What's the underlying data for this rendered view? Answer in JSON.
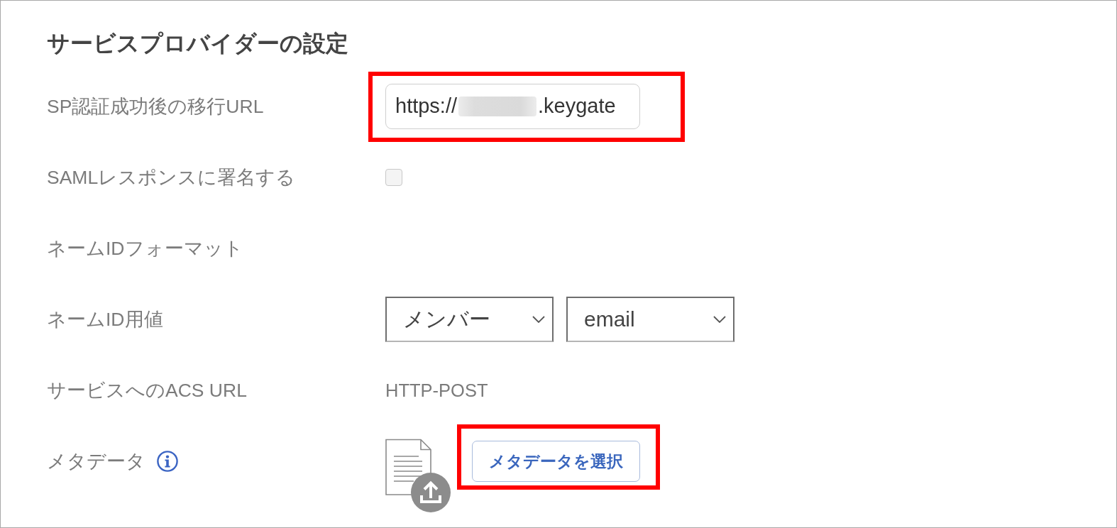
{
  "title": "サービスプロバイダーの設定",
  "rows": [
    {
      "kind": "text_input",
      "label": "SP認証成功後の移行URL",
      "value_start": "https://",
      "value_end": ".keygate",
      "redacted": true,
      "highlighted": true
    },
    {
      "kind": "checkbox",
      "label": "SAMLレスポンスに署名する",
      "checked": false
    },
    {
      "kind": "label_only",
      "label": "ネームIDフォーマット"
    },
    {
      "kind": "selects",
      "label": "ネームID用値",
      "selects": [
        {
          "value": "メンバー"
        },
        {
          "value": "email"
        }
      ]
    },
    {
      "kind": "text",
      "label": "サービスへのACS URL",
      "value": "HTTP-POST"
    },
    {
      "kind": "upload",
      "label": "メタデータ",
      "info": true,
      "button": "メタデータを選択",
      "highlighted": true
    }
  ]
}
